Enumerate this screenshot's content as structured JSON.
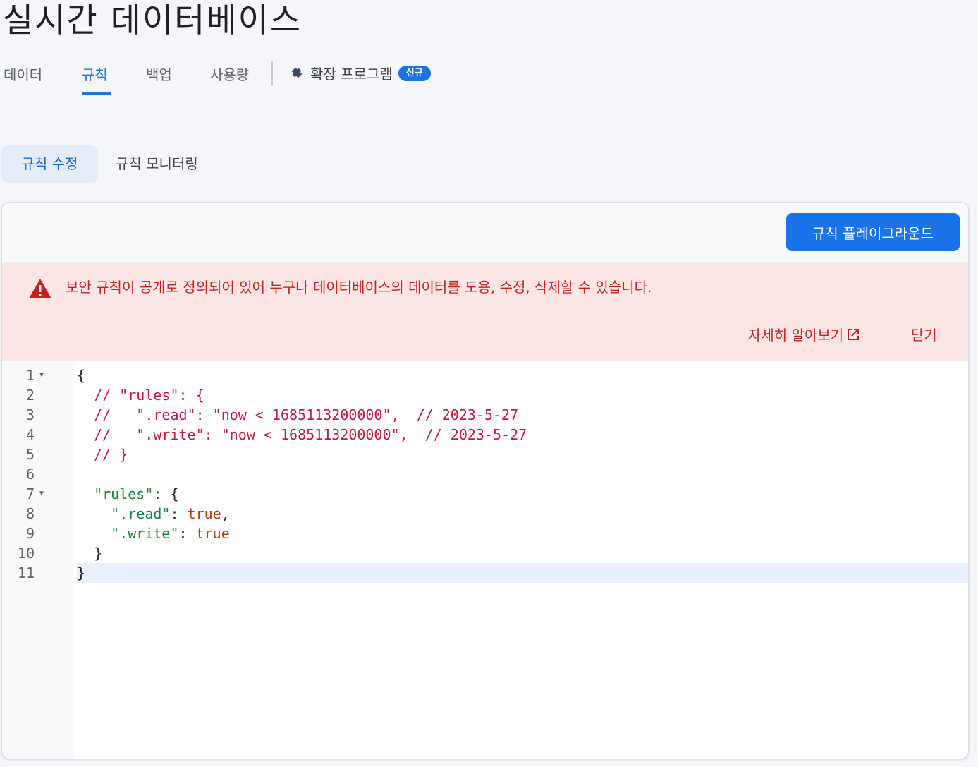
{
  "page": {
    "title": "실시간 데이터베이스"
  },
  "top_tabs": {
    "data": "데이터",
    "rules": "규칙",
    "backup": "백업",
    "usage": "사용량",
    "extensions": "확장 프로그램",
    "new_badge": "신규"
  },
  "sub_tabs": {
    "edit": "규칙 수정",
    "monitor": "규칙 모니터링"
  },
  "toolbar": {
    "playground_label": "규칙 플레이그라운드"
  },
  "warning": {
    "message": "보안 규칙이 공개로 정의되어 있어 누구나 데이터베이스의 데이터를 도용, 수정, 삭제할 수 있습니다.",
    "learn_more": "자세히 알아보기",
    "close": "닫기"
  },
  "editor": {
    "line_numbers": [
      "1",
      "2",
      "3",
      "4",
      "5",
      "6",
      "7",
      "8",
      "9",
      "10",
      "11"
    ],
    "lines": {
      "l1": "{",
      "l2": "  // \"rules\": {",
      "l3": "  //   \".read\": \"now < 1685113200000\",  // 2023-5-27",
      "l4": "  //   \".write\": \"now < 1685113200000\",  // 2023-5-27",
      "l5": "  // }",
      "l7_indent": "  ",
      "l7_key": "\"rules\"",
      "l7_rest": ": {",
      "l8_indent": "    ",
      "l8_key": "\".read\"",
      "l8_colon": ": ",
      "l8_val": "true",
      "l8_comma": ",",
      "l9_indent": "    ",
      "l9_key": "\".write\"",
      "l9_colon": ": ",
      "l9_val": "true",
      "l10": "  }",
      "l11": "}"
    }
  },
  "colors": {
    "accent": "#1a73e8",
    "warning_bg": "#fbe6e5",
    "warning_text": "#c5221f",
    "comment": "#c41a3f",
    "string": "#188038",
    "boolean": "#b53f0f"
  }
}
